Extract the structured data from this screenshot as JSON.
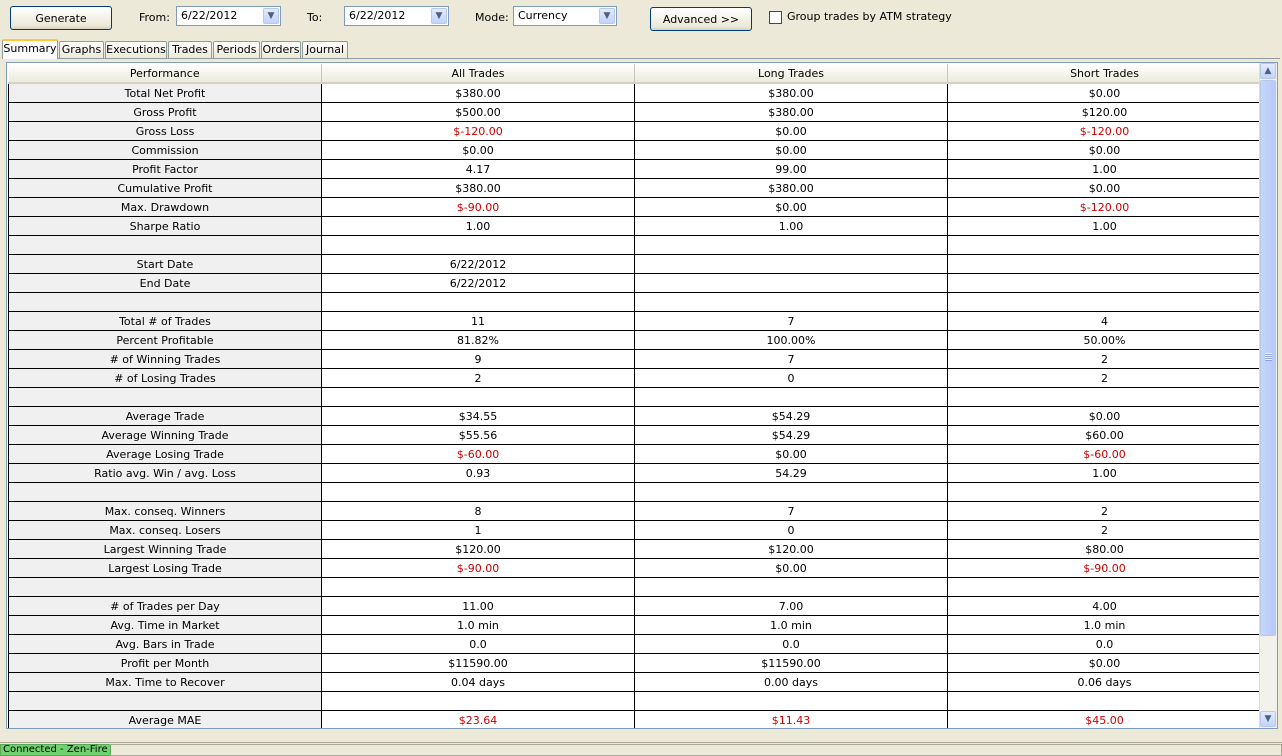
{
  "toolbar": {
    "generate_label": "Generate",
    "from_label": "From:",
    "from_value": "6/22/2012",
    "to_label": "To:",
    "to_value": "6/22/2012",
    "mode_label": "Mode:",
    "mode_value": "Currency",
    "advanced_label": "Advanced >>",
    "group_label": "Group trades by ATM strategy"
  },
  "tabs": [
    "Summary",
    "Graphs",
    "Executions",
    "Trades",
    "Periods",
    "Orders",
    "Journal"
  ],
  "table": {
    "headers": [
      "Performance",
      "All Trades",
      "Long Trades",
      "Short Trades"
    ],
    "rows": [
      {
        "label": "Total Net Profit",
        "values": [
          "$380.00",
          "$380.00",
          "$0.00"
        ]
      },
      {
        "label": "Gross Profit",
        "values": [
          "$500.00",
          "$380.00",
          "$120.00"
        ]
      },
      {
        "label": "Gross Loss",
        "values": [
          "$-120.00",
          "$0.00",
          "$-120.00"
        ],
        "neg": [
          true,
          false,
          true
        ]
      },
      {
        "label": "Commission",
        "values": [
          "$0.00",
          "$0.00",
          "$0.00"
        ]
      },
      {
        "label": "Profit Factor",
        "values": [
          "4.17",
          "99.00",
          "1.00"
        ]
      },
      {
        "label": "Cumulative Profit",
        "values": [
          "$380.00",
          "$380.00",
          "$0.00"
        ]
      },
      {
        "label": "Max. Drawdown",
        "values": [
          "$-90.00",
          "$0.00",
          "$-120.00"
        ],
        "neg": [
          true,
          false,
          true
        ]
      },
      {
        "label": "Sharpe Ratio",
        "values": [
          "1.00",
          "1.00",
          "1.00"
        ]
      },
      {
        "label": "",
        "values": [
          "",
          "",
          ""
        ]
      },
      {
        "label": "Start Date",
        "values": [
          "6/22/2012",
          "",
          ""
        ]
      },
      {
        "label": "End Date",
        "values": [
          "6/22/2012",
          "",
          ""
        ]
      },
      {
        "label": "",
        "values": [
          "",
          "",
          ""
        ]
      },
      {
        "label": "Total # of Trades",
        "values": [
          "11",
          "7",
          "4"
        ]
      },
      {
        "label": "Percent Profitable",
        "values": [
          "81.82%",
          "100.00%",
          "50.00%"
        ]
      },
      {
        "label": "# of Winning Trades",
        "values": [
          "9",
          "7",
          "2"
        ]
      },
      {
        "label": "# of Losing Trades",
        "values": [
          "2",
          "0",
          "2"
        ]
      },
      {
        "label": "",
        "values": [
          "",
          "",
          ""
        ]
      },
      {
        "label": "Average Trade",
        "values": [
          "$34.55",
          "$54.29",
          "$0.00"
        ]
      },
      {
        "label": "Average Winning Trade",
        "values": [
          "$55.56",
          "$54.29",
          "$60.00"
        ]
      },
      {
        "label": "Average Losing Trade",
        "values": [
          "$-60.00",
          "$0.00",
          "$-60.00"
        ],
        "neg": [
          true,
          false,
          true
        ]
      },
      {
        "label": "Ratio avg. Win / avg. Loss",
        "values": [
          "0.93",
          "54.29",
          "1.00"
        ]
      },
      {
        "label": "",
        "values": [
          "",
          "",
          ""
        ]
      },
      {
        "label": "Max. conseq. Winners",
        "values": [
          "8",
          "7",
          "2"
        ]
      },
      {
        "label": "Max. conseq. Losers",
        "values": [
          "1",
          "0",
          "2"
        ]
      },
      {
        "label": "Largest Winning Trade",
        "values": [
          "$120.00",
          "$120.00",
          "$80.00"
        ]
      },
      {
        "label": "Largest Losing Trade",
        "values": [
          "$-90.00",
          "$0.00",
          "$-90.00"
        ],
        "neg": [
          true,
          false,
          true
        ]
      },
      {
        "label": "",
        "values": [
          "",
          "",
          ""
        ]
      },
      {
        "label": "# of Trades per Day",
        "values": [
          "11.00",
          "7.00",
          "4.00"
        ]
      },
      {
        "label": "Avg. Time in Market",
        "values": [
          "1.0 min",
          "1.0 min",
          "1.0 min"
        ]
      },
      {
        "label": "Avg. Bars in Trade",
        "values": [
          "0.0",
          "0.0",
          "0.0"
        ]
      },
      {
        "label": "Profit per Month",
        "values": [
          "$11590.00",
          "$11590.00",
          "$0.00"
        ]
      },
      {
        "label": "Max. Time to Recover",
        "values": [
          "0.04 days",
          "0.00 days",
          "0.06 days"
        ]
      },
      {
        "label": "",
        "values": [
          "",
          "",
          ""
        ]
      },
      {
        "label": "Average MAE",
        "values": [
          "$23.64",
          "$11.43",
          "$45.00"
        ],
        "neg": [
          true,
          true,
          true
        ]
      }
    ]
  },
  "status": {
    "connection": "Connected - Zen-Fire"
  },
  "colors": {
    "negative": "#cc0000",
    "connected": "#6ed36e",
    "tab_highlight": "#ffc73c"
  }
}
